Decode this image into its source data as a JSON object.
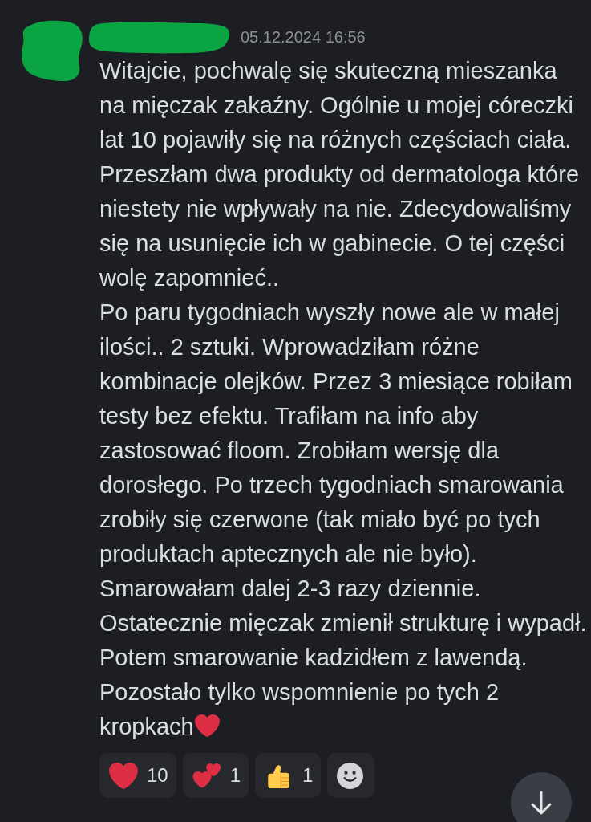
{
  "message": {
    "timestamp": "05.12.2024 16:56",
    "paragraphs": [
      "Witajcie, pochwalę się skuteczną mieszanka na mięczak zakaźny. Ogólnie u mojej córeczki lat 10 pojawiły się na różnych częściach ciała. Przeszłam dwa produkty od dermatologa które niestety nie wpływały na nie. Zdecydowaliśmy się na usunięcie ich w gabinecie. O tej części wolę zapomnieć..",
      "Po paru tygodniach wyszły nowe ale w małej ilości.. 2 sztuki. Wprowadziłam różne kombinacje olejków. Przez 3 miesiące robiłam testy bez efektu. Trafiłam na info aby zastosować floom. Zrobiłam wersję dla dorosłego. Po trzech tygodniach smarowania zrobiły się czerwone (tak miało być po tych produktach aptecznych ale nie było). Smarowałam dalej 2-3 razy dziennie. Ostatecznie mięczak zmienił strukturę i wypadł. Potem smarowanie kadzidłem z lawendą. Pozostało tylko wspomnienie po tych 2 kropkach"
    ],
    "reactions": [
      {
        "kind": "heart",
        "count": "10"
      },
      {
        "kind": "two-hearts",
        "count": "1"
      },
      {
        "kind": "thumbs-up",
        "count": "1"
      },
      {
        "kind": "add"
      }
    ]
  }
}
